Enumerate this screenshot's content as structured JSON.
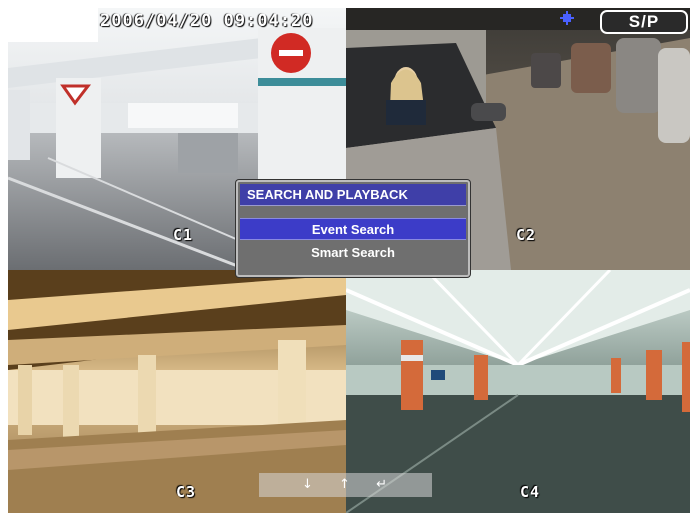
{
  "osd": {
    "timestamp": "2006/04/20 09:04:20",
    "mode_button": "S/P",
    "record_icon": "recording-indicator-icon"
  },
  "cameras": [
    {
      "label": "C1"
    },
    {
      "label": "C2"
    },
    {
      "label": "C3"
    },
    {
      "label": "C4"
    }
  ],
  "menu": {
    "title": "SEARCH AND PLAYBACK",
    "items": [
      {
        "label": "Event Search",
        "selected": true
      },
      {
        "label": "Smart Search",
        "selected": false
      }
    ]
  },
  "nav_hint": {
    "down": "↓",
    "up": "↑",
    "enter": "↵"
  },
  "colors": {
    "menu_title_bg": "#3f3fa8",
    "menu_selected_bg": "#3c3cc8",
    "menu_bg": "#6f6f6f"
  }
}
